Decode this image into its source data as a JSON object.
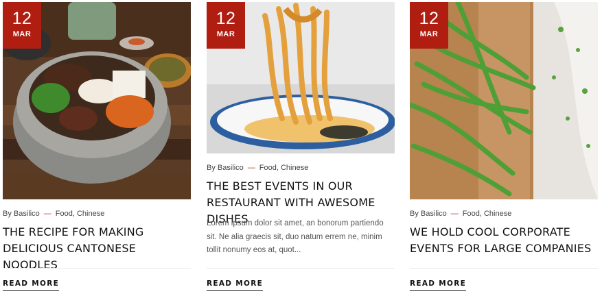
{
  "cards": [
    {
      "date": {
        "day": "12",
        "month": "MAR"
      },
      "meta": {
        "author": "By Basilico",
        "categories": "Food, Chinese"
      },
      "title": "THE RECIPE FOR MAKING DELICIOUS CANTONESE NOODLES",
      "read_more": "READ MORE"
    },
    {
      "date": {
        "day": "12",
        "month": "MAR"
      },
      "meta": {
        "author": "By Basilico",
        "categories": "Food, Chinese"
      },
      "title": "THE BEST EVENTS IN OUR RESTAURANT WITH AWESOME DISHES",
      "excerpt": "Lorem ipsum dolor sit amet, an bonorum partiendo sit. Ne alia graecis sit, duo natum errem ne, minim tollit nonumy eos at, quot...",
      "read_more": "READ MORE"
    },
    {
      "date": {
        "day": "12",
        "month": "MAR"
      },
      "meta": {
        "author": "By Basilico",
        "categories": "Food, Chinese"
      },
      "title": "WE HOLD COOL CORPORATE EVENTS FOR LARGE COMPANIES",
      "read_more": "READ MORE"
    }
  ],
  "colors": {
    "accent": "#b01e12",
    "text": "#111111",
    "muted": "#555555"
  }
}
